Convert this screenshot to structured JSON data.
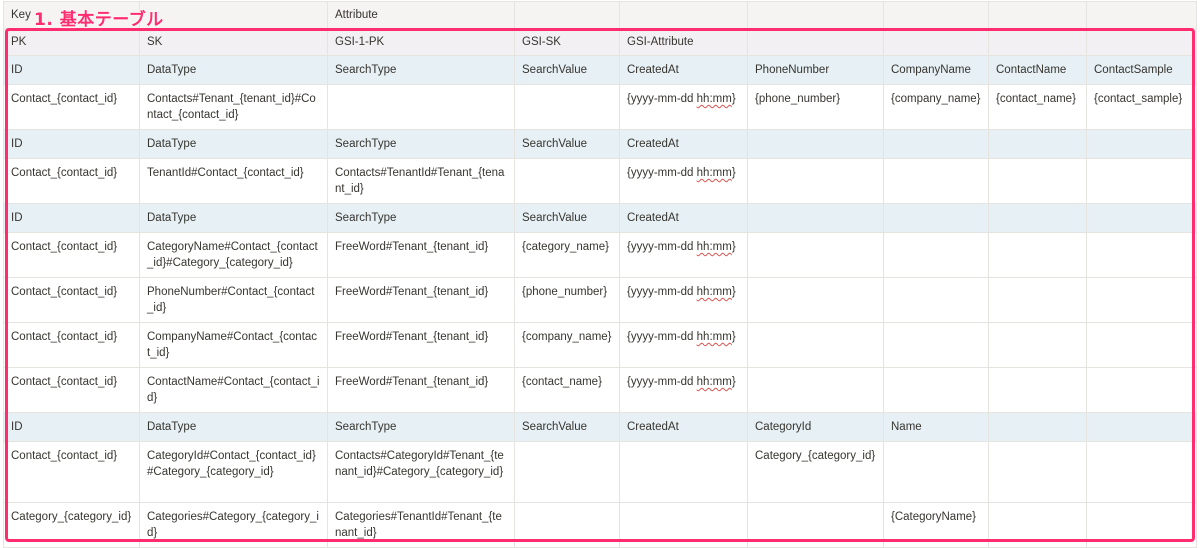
{
  "annotation": {
    "label": "1. 基本テーブル",
    "color": "#ff2d6f"
  },
  "table": {
    "key_row": [
      "Key",
      "",
      "Attribute",
      "",
      "",
      "",
      "",
      "",
      ""
    ],
    "pk_row": [
      "PK",
      "SK",
      "GSI-1-PK",
      "GSI-SK",
      "GSI-Attribute",
      "",
      "",
      "",
      ""
    ],
    "sections": [
      {
        "header": [
          "ID",
          "DataType",
          "SearchType",
          "SearchValue",
          "CreatedAt",
          "PhoneNumber",
          "CompanyName",
          "ContactName",
          "ContactSample"
        ],
        "rows": [
          [
            "Contact_{contact_id}",
            "Contacts#Tenant_{tenant_id}#Contact_{contact_id}",
            "",
            "",
            "{yyyy-mm-dd hh:mm}",
            "{phone_number}",
            "{company_name}",
            "{contact_name}",
            "{contact_sample}"
          ]
        ]
      },
      {
        "header": [
          "ID",
          "DataType",
          "SearchType",
          "SearchValue",
          "CreatedAt",
          "",
          "",
          "",
          ""
        ],
        "rows": [
          [
            "Contact_{contact_id}",
            "TenantId#Contact_{contact_id}",
            "Contacts#TenantId#Tenant_{tenant_id}",
            "",
            "{yyyy-mm-dd hh:mm}",
            "",
            "",
            "",
            ""
          ]
        ]
      },
      {
        "header": [
          "ID",
          "DataType",
          "SearchType",
          "SearchValue",
          "CreatedAt",
          "",
          "",
          "",
          ""
        ],
        "rows": [
          [
            "Contact_{contact_id}",
            "CategoryName#Contact_{contact_id}#Category_{category_id}",
            "FreeWord#Tenant_{tenant_id}",
            "{category_name}",
            "{yyyy-mm-dd hh:mm}",
            "",
            "",
            "",
            ""
          ],
          [
            "Contact_{contact_id}",
            "PhoneNumber#Contact_{contact_id}",
            "FreeWord#Tenant_{tenant_id}",
            "{phone_number}",
            "{yyyy-mm-dd hh:mm}",
            "",
            "",
            "",
            ""
          ],
          [
            "Contact_{contact_id}",
            "CompanyName#Contact_{contact_id}",
            "FreeWord#Tenant_{tenant_id}",
            "{company_name}",
            "{yyyy-mm-dd hh:mm}",
            "",
            "",
            "",
            ""
          ],
          [
            "Contact_{contact_id}",
            "ContactName#Contact_{contact_id}",
            "FreeWord#Tenant_{tenant_id}",
            "{contact_name}",
            "{yyyy-mm-dd hh:mm}",
            "",
            "",
            "",
            ""
          ]
        ]
      },
      {
        "header": [
          "ID",
          "DataType",
          "SearchType",
          "SearchValue",
          "CreatedAt",
          "CategoryId",
          "Name",
          "",
          ""
        ],
        "rows": [
          [
            "Contact_{contact_id}",
            "CategoryId#Contact_{contact_id}#Category_{category_id}",
            "Contacts#CategoryId#Tenant_{tenant_id}#Category_{category_id}",
            "",
            "",
            "Category_{category_id}",
            "",
            "",
            ""
          ],
          [
            "Category_{category_id}",
            "Categories#Category_{category_id}",
            "Categories#TenantId#Tenant_{tenant_id}",
            "",
            "",
            "",
            "{CategoryName}",
            "",
            ""
          ]
        ]
      }
    ]
  }
}
